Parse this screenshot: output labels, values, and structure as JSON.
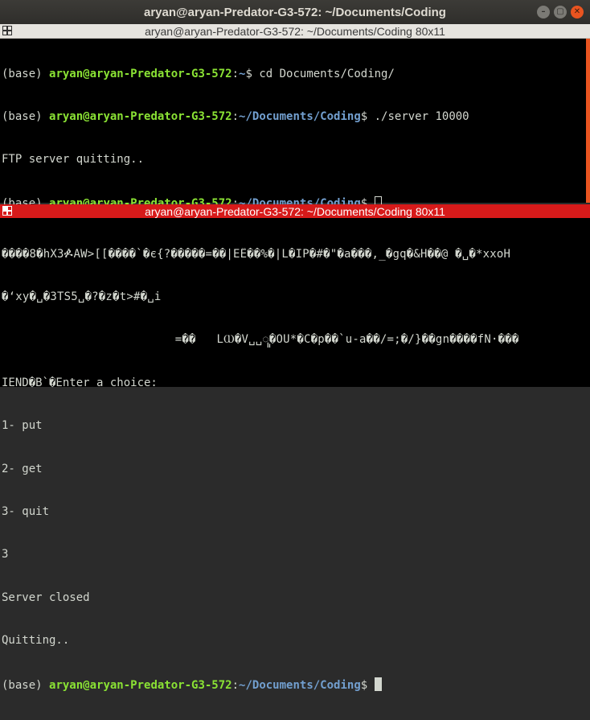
{
  "window": {
    "title": "aryan@aryan-Predator-G3-572: ~/Documents/Coding",
    "buttons": {
      "minimize": "–",
      "maximize": "▢",
      "close": "✕"
    }
  },
  "pane_top": {
    "title": "aryan@aryan-Predator-G3-572: ~/Documents/Coding 80x11",
    "lines": [
      {
        "env": "(base) ",
        "user": "aryan@aryan-Predator-G3-572",
        "sep": ":",
        "path": "~",
        "prompt": "$ ",
        "cmd": "cd Documents/Coding/"
      },
      {
        "env": "(base) ",
        "user": "aryan@aryan-Predator-G3-572",
        "sep": ":",
        "path": "~/Documents/Coding",
        "prompt": "$ ",
        "cmd": "./server 10000"
      },
      {
        "output": "FTP server quitting.."
      },
      {
        "env": "(base) ",
        "user": "aryan@aryan-Predator-G3-572",
        "sep": ":",
        "path": "~/Documents/Coding",
        "prompt": "$ ",
        "cmd": ""
      }
    ]
  },
  "pane_bottom": {
    "title": "aryan@aryan-Predator-G3-572: ~/Documents/Coding 80x11",
    "garbled": [
      "����8�hX3ⶍAW>[[����`�є{?�����=��|EЁ��%�|L�IP�#�\"�a���,_�gq�&H��@ �␣�*xxoH",
      "�ʻxy�␣�3TS5␣�?�z�t>#�␣i",
      "                         =��   LⲰ�V␣␣ꦸ�OU*�C�p��`u-a��/=;�/}��gn����fN·���"
    ],
    "output": [
      "IEND�B`�Enter a choice:",
      "1- put",
      "2- get",
      "3- quit",
      "3",
      "Server closed",
      "Quitting.."
    ],
    "prompt": {
      "env": "(base) ",
      "user": "aryan@aryan-Predator-G3-572",
      "sep": ":",
      "path": "~/Documents/Coding",
      "prompt": "$ "
    }
  },
  "colors": {
    "user": "#8ae234",
    "path": "#729fcf",
    "text": "#d3d7cf",
    "active_header": "#d71a1a",
    "accent": "#e95420"
  }
}
